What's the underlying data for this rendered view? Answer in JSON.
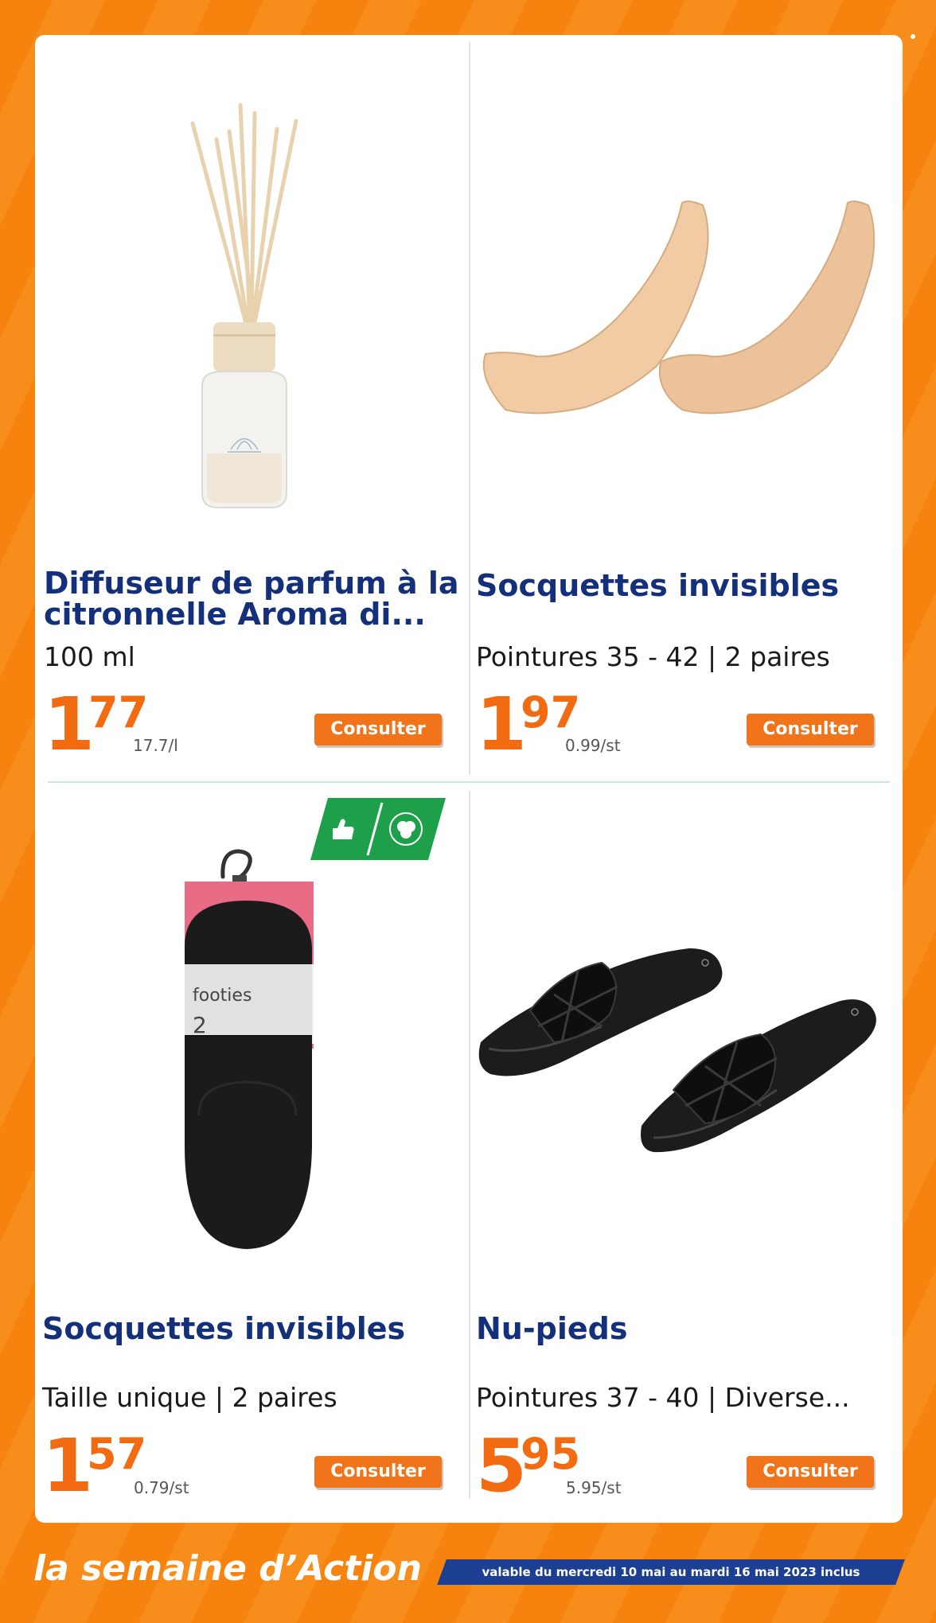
{
  "products": [
    {
      "title_line1": "Diffuseur de parfum à la",
      "title_line2": "citronnelle Aroma di...",
      "subtitle": "100 ml",
      "price_int": "1",
      "price_dec": "77",
      "unit_price": "17.7/l",
      "button_label": "Consulter",
      "image_icon": "reed-diffuser-image"
    },
    {
      "title_line1": "Socquettes invisibles",
      "subtitle": "Pointures 35 - 42 | 2 paires",
      "price_int": "1",
      "price_dec": "97",
      "unit_price": "0.99/st",
      "button_label": "Consulter",
      "image_icon": "invisible-socks-image"
    },
    {
      "title_line1": "Socquettes invisibles",
      "subtitle": "Taille unique | 2 paires",
      "price_int": "1",
      "price_dec": "57",
      "unit_price": "0.79/st",
      "button_label": "Consulter",
      "image_icon": "black-footies-image",
      "package_text": "footies",
      "package_count": "2"
    },
    {
      "title_line1": "Nu-pieds",
      "subtitle": "Pointures 37 - 40 | Diverse...",
      "price_int": "5",
      "price_dec": "95",
      "unit_price": "5.95/st",
      "button_label": "Consulter",
      "image_icon": "black-sandals-image"
    }
  ],
  "footer": {
    "title": "la semaine d’Action",
    "validity": "valable du mercredi 10 mai au mardi 16 mai 2023 inclus"
  },
  "colors": {
    "background": "#f7830f",
    "title": "#15307a",
    "price": "#f26b10",
    "button": "#f2741a",
    "footer_band": "#1c3f94",
    "badge": "#1ea04a"
  }
}
